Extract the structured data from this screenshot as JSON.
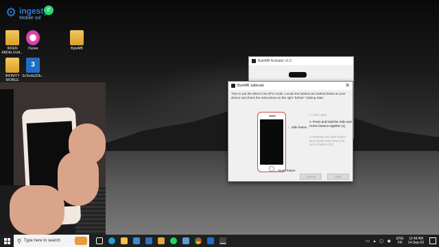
{
  "watermark": {
    "title": "ingesty",
    "subtitle": "Mobile sol"
  },
  "desktop_icons": [
    {
      "label": "IKREN ABDELOUA...",
      "icon": "folder-icon"
    },
    {
      "label": "iTunes",
      "icon": "itunes-icon"
    },
    {
      "label": "ByteMB",
      "icon": "folder-icon"
    },
    {
      "label": "INFINITY MOBILE",
      "icon": "folder-icon"
    },
    {
      "label": "3uTools(32b...",
      "icon": "3utools-icon"
    }
  ],
  "bg_window": {
    "title": "ByteMB Activator v1.0"
  },
  "dialog": {
    "title": "ByteMB Jailbreak",
    "instructions": "Time to put the device into DFU mode. Locate the buttons as marked below on your device and check the instructions on the right \"before\" clicking Start.",
    "side_button_label": "← Side button",
    "home_button_label": "← Home button",
    "steps": [
      "1. Click Start",
      "2. Press and hold the Side and Home buttons together (1)",
      "3. Release the Side button BUT KEEP HOLDING the Home button (10)"
    ],
    "cancel_label": "Cancel",
    "start_label": "Start"
  },
  "taskbar": {
    "search_placeholder": "Type here to search",
    "lang_top": "ENG",
    "lang_bottom": "FR",
    "time": "12:48 AM",
    "date": "14-Sep-23"
  }
}
